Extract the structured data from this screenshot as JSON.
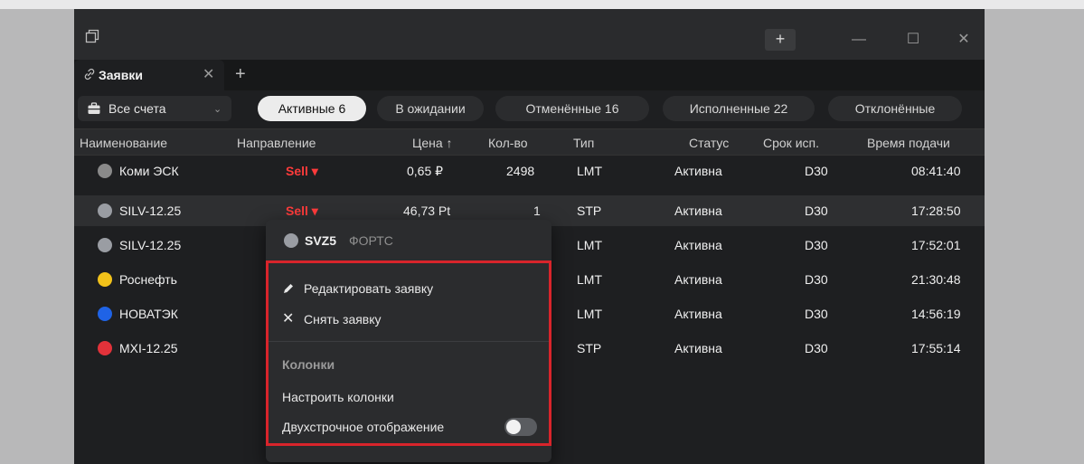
{
  "titlebar": {
    "app_icon": "window-restore-icon",
    "new_button": "+",
    "minimize": "—",
    "maximize": "☐",
    "close": "✕"
  },
  "tab": {
    "label": "Заявки",
    "close": "✕",
    "add": "+"
  },
  "filter": {
    "accounts_label": "Все счета",
    "pills": [
      "Активные 6",
      "В ожидании",
      "Отменённые 16",
      "Исполненные 22",
      "Отклонённые"
    ]
  },
  "table": {
    "columns": [
      "Наименование",
      "Направление",
      "Цена ↑",
      "Кол-во",
      "Тип",
      "Статус",
      "Срок исп.",
      "Время подачи"
    ],
    "rows": [
      {
        "name": "Коми ЭСК",
        "icon_color": "#8a8a8a",
        "side": "Sell",
        "price": "0,65 ₽",
        "qty": "2498",
        "type": "LMT",
        "status": "Активна",
        "term": "D30",
        "time": "08:41:40"
      },
      {
        "name": "SILV-12.25",
        "icon_color": "#9a9da3",
        "side": "Sell",
        "price": "46,73 Pt",
        "qty": "1",
        "type": "STP",
        "status": "Активна",
        "term": "D30",
        "time": "17:28:50"
      },
      {
        "name": "SILV-12.25",
        "icon_color": "#9a9da3",
        "side": "",
        "price": "",
        "qty": "",
        "type": "LMT",
        "status": "Активна",
        "term": "D30",
        "time": "17:52:01"
      },
      {
        "name": "Роснефть",
        "icon_color": "#f2c21a",
        "side": "",
        "price": "",
        "qty": "",
        "type": "LMT",
        "status": "Активна",
        "term": "D30",
        "time": "21:30:48"
      },
      {
        "name": "НОВАТЭК",
        "icon_color": "#1f63e6",
        "side": "",
        "price": "",
        "qty": "",
        "type": "LMT",
        "status": "Активна",
        "term": "D30",
        "time": "14:56:19"
      },
      {
        "name": "MXI-12.25",
        "icon_color": "#e2323a",
        "side": "",
        "price": "",
        "qty": "",
        "type": "STP",
        "status": "Активна",
        "term": "D30",
        "time": "17:55:14"
      }
    ]
  },
  "menu": {
    "ticker": "SVZ5",
    "market": "ФОРТС",
    "edit": "Редактировать заявку",
    "cancel": "Снять заявку",
    "section": "Колонки",
    "configure": "Настроить колонки",
    "two_line": "Двухстрочное отображение",
    "two_line_enabled": false
  },
  "colors": {
    "accent_sell": "#ff3b3b",
    "highlight_box": "#d8242b"
  }
}
